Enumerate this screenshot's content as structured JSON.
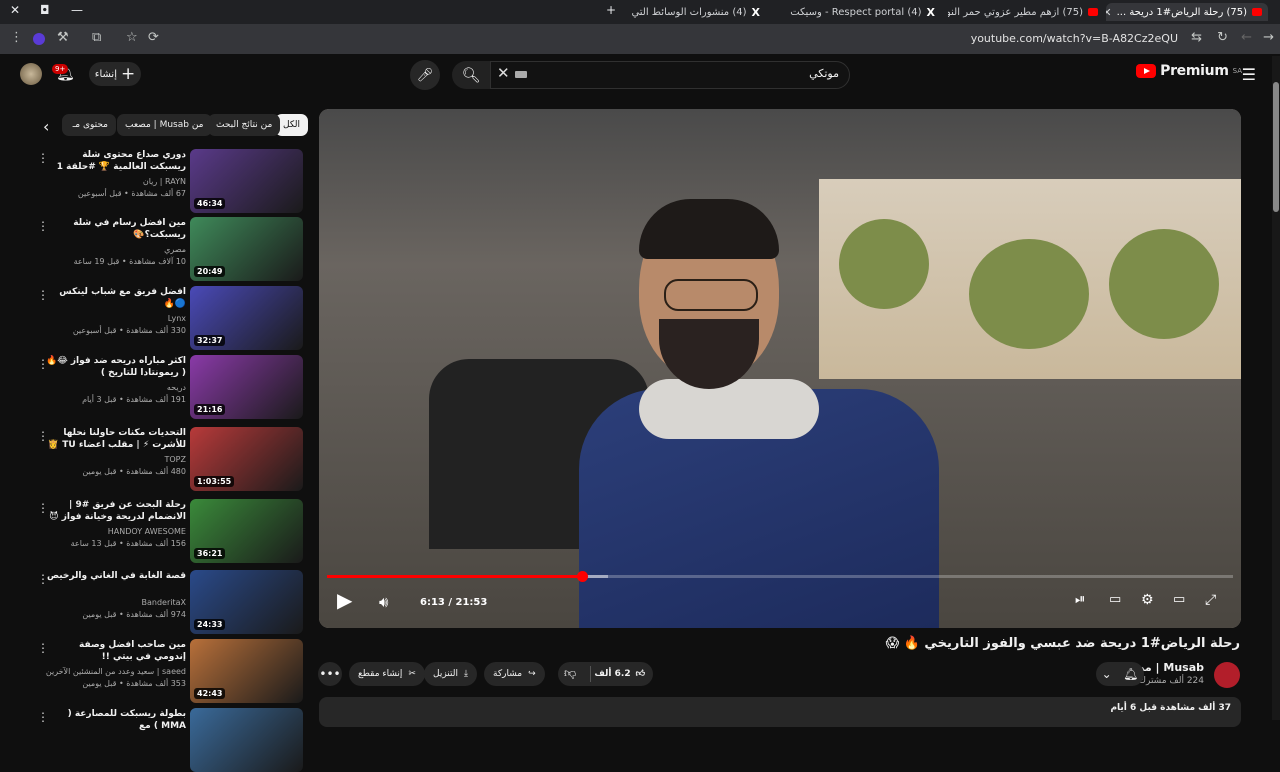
{
  "browser": {
    "tabs": [
      {
        "label": "(75) رحلة الرياض#1 دريحة ...",
        "icon": "youtube-icon",
        "active": true
      },
      {
        "label": "(75) ازهم مطير عزوتي حمر النوا...",
        "icon": "youtube-icon",
        "active": false
      },
      {
        "label": "(4) Respect portal - وسيكت على...",
        "icon": "x-icon",
        "active": false
      },
      {
        "label": "(4) منشورات الوسائط التي نشرها...",
        "icon": "x-icon",
        "active": false
      }
    ],
    "new_tab": "+",
    "url": "youtube.com/watch?v=B-A82Cz2eQU"
  },
  "masthead": {
    "logo_text": "Premium",
    "logo_region": "SA",
    "search_query": "موتكي",
    "create_label": "إنشاء",
    "notification_count": "9+"
  },
  "chips": [
    {
      "label": "الكل",
      "active": true
    },
    {
      "label": "من نتائج البحث",
      "active": false
    },
    {
      "label": "من Musab | مصعب",
      "active": false
    },
    {
      "label": "محتوى مـ",
      "active": false
    }
  ],
  "recommendations": [
    {
      "title": "دوري صداع محتوى شلة ريسبكت العالمية 🏆 #حلقة 1",
      "channel": "RAYN | ريان",
      "meta": "67 ألف مشاهدة • قبل أسبوعين",
      "duration": "46:34",
      "thumb_color": "#5a3a8a"
    },
    {
      "title": "مين افضل رسام في شلة ريسبكت؟🎨",
      "channel": "مصري",
      "meta": "10 آلاف مشاهدة • قبل 19 ساعة",
      "duration": "20:49",
      "thumb_color": "#3f8a5a"
    },
    {
      "title": "افضل فريق مع شباب لينكس 🔵🔥",
      "channel": "Lynx",
      "meta": "330 ألف مشاهدة • قبل أسبوعين",
      "duration": "32:37",
      "thumb_color": "#4a4ab8"
    },
    {
      "title": "اكثر مباراه دريحه ضد فواز 😂🔥 ( ريمونتادا للتاريخ )",
      "channel": "دريحه",
      "meta": "191 ألف مشاهدة • قبل 3 أيام",
      "duration": "21:16",
      "thumb_color": "#8a3aa8"
    },
    {
      "title": "التحديات مكنات حاولنا نحلها للأشرت ⚡ | مقلب اعضاء TU 👸🔥",
      "channel": "TOPZ",
      "meta": "480 ألف مشاهدة • قبل يومين",
      "duration": "1:03:55",
      "thumb_color": "#b83a3a"
    },
    {
      "title": "رحلة البحث عن فريق #9 | الانضمام لدريحة وخيانة فواز 😈",
      "channel": "HANDOY AWESOME",
      "meta": "156 ألف مشاهدة • قبل 13 ساعة",
      "duration": "36:21",
      "thumb_color": "#3a8a3a"
    },
    {
      "title": "قصة الغابة في الغاني والرخيص",
      "channel": "BanderitaX",
      "meta": "974 ألف مشاهدة • قبل يومين",
      "duration": "24:33",
      "thumb_color": "#2a4a8a"
    },
    {
      "title": "مين صاحب افضل وصفة إندومي في بيتي !!",
      "channel": "saeed | سعيد وعدد من المنشئين الآخرين",
      "meta": "353 ألف مشاهدة • قبل يومين",
      "duration": "42:43",
      "thumb_color": "#b8703a"
    },
    {
      "title": "بطولة ريسبكت للمصارعة ( MMA ) مع",
      "channel": "",
      "meta": "",
      "duration": "",
      "thumb_color": "#3a6a9a"
    }
  ],
  "player": {
    "time": "6:13 / 21:53",
    "progress": 0.282,
    "buffered": 0.31
  },
  "video": {
    "title": "رحلة الرياض#1 دريحة ضد عبسي والفوز التاريخي 🔥 😱",
    "channel": "Musab | مصعب",
    "subscribers": "224 ألف مشترك",
    "likes": "6.2 ألف",
    "share": "مشاركة",
    "download": "التنزيل",
    "clip": "إنشاء مقطع",
    "description_meta": "37 ألف مشاهدة قبل 6 أيام"
  },
  "colors": {
    "accent": "#ff0000",
    "background": "#0f0f0f",
    "chip": "#272727"
  }
}
